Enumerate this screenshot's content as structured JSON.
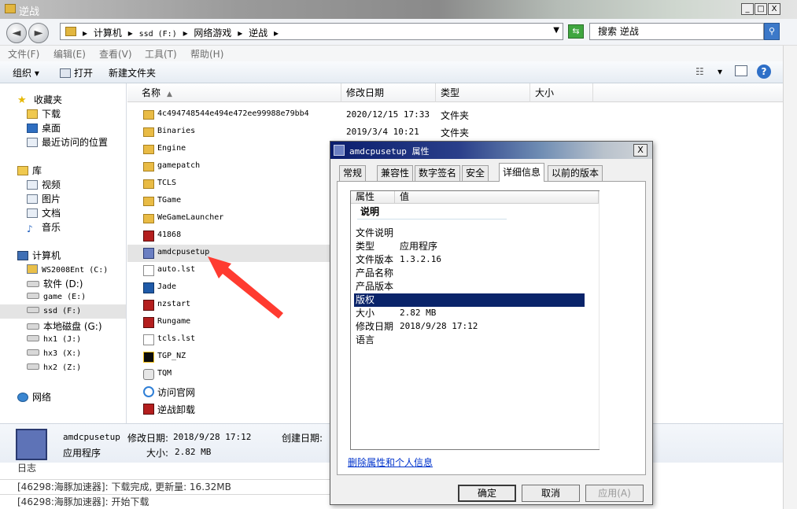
{
  "window": {
    "title": "逆战",
    "minimize": "_",
    "maximize": "□",
    "close": "X"
  },
  "address": {
    "crumbs": [
      "计算机",
      "▸",
      "ssd (F:)",
      "▸",
      "网络游戏",
      "▸",
      "逆战",
      "▸"
    ],
    "back": "◄",
    "forward": "►",
    "search_placeholder": "搜索 逆战"
  },
  "menu": {
    "file": "文件(F)",
    "edit": "编辑(E)",
    "view": "查看(V)",
    "tools": "工具(T)",
    "help": "帮助(H)"
  },
  "toolbar": {
    "organize": "组织 ▾",
    "open": "打开",
    "new_folder": "新建文件夹",
    "view_toggle": "▾",
    "help": "?"
  },
  "nav": {
    "favorites": "收藏夹",
    "downloads": "下载",
    "desktop": "桌面",
    "recent": "最近访问的位置",
    "libraries": "库",
    "videos": "视频",
    "pictures": "图片",
    "documents": "文档",
    "music": "音乐",
    "computer": "计算机",
    "drives": [
      "WS2008Ent (C:)",
      "软件 (D:)",
      "game (E:)",
      "ssd (F:)",
      "本地磁盘 (G:)",
      "hx1 (J:)",
      "hx3 (X:)",
      "hx2 (Z:)"
    ],
    "network": "网络"
  },
  "columns": {
    "name": "名称",
    "modified": "修改日期",
    "type": "类型",
    "size": "大小"
  },
  "files": [
    {
      "name": "4c494748544e494e472ee99988e79bb4",
      "date": "2020/12/15 17:33",
      "type": "文件夹"
    },
    {
      "name": "Binaries",
      "date": "2019/3/4 10:21",
      "type": "文件夹"
    },
    {
      "name": "Engine",
      "date": "",
      "type": ""
    },
    {
      "name": "gamepatch",
      "date": "",
      "type": ""
    },
    {
      "name": "TCLS",
      "date": "",
      "type": ""
    },
    {
      "name": "TGame",
      "date": "",
      "type": ""
    },
    {
      "name": "WeGameLauncher",
      "date": "",
      "type": ""
    },
    {
      "name": "41868",
      "date": "",
      "type": ""
    },
    {
      "name": "amdcpusetup",
      "date": "",
      "type": ""
    },
    {
      "name": "auto.lst",
      "date": "",
      "type": ""
    },
    {
      "name": "Jade",
      "date": "",
      "type": ""
    },
    {
      "name": "nzstart",
      "date": "",
      "type": ""
    },
    {
      "name": "Rungame",
      "date": "",
      "type": ""
    },
    {
      "name": "tcls.lst",
      "date": "",
      "type": ""
    },
    {
      "name": "TGP_NZ",
      "date": "",
      "type": ""
    },
    {
      "name": "TQM",
      "date": "",
      "type": ""
    },
    {
      "name": "访问官网",
      "date": "",
      "type": ""
    },
    {
      "name": "逆战卸载",
      "date": "",
      "type": ""
    }
  ],
  "details": {
    "name": "amdcpusetup",
    "modified_label": "修改日期:",
    "modified": "2018/9/28 17:12",
    "created_label": "创建日期:",
    "type": "应用程序",
    "size_label": "大小:",
    "size": "2.82 MB"
  },
  "log": {
    "title": "日志",
    "lines": [
      "[46298:海豚加速器]: 下载完成, 更新量: 16.32MB",
      "[46298:海豚加速器]: 开始下载"
    ]
  },
  "dialog": {
    "title": "amdcpusetup 属性",
    "close": "X",
    "tabs": [
      "常规",
      "兼容性",
      "数字签名",
      "安全",
      "详细信息",
      "以前的版本"
    ],
    "active_tab": "详细信息",
    "header_property": "属性",
    "header_value": "值",
    "section": "说明",
    "rows": [
      {
        "key": "文件说明",
        "value": ""
      },
      {
        "key": "类型",
        "value": "应用程序"
      },
      {
        "key": "文件版本",
        "value": "1.3.2.16"
      },
      {
        "key": "产品名称",
        "value": ""
      },
      {
        "key": "产品版本",
        "value": ""
      },
      {
        "key": "版权",
        "value": ""
      },
      {
        "key": "大小",
        "value": "2.82 MB"
      },
      {
        "key": "修改日期",
        "value": "2018/9/28 17:12"
      },
      {
        "key": "语言",
        "value": ""
      }
    ],
    "remove_link": "删除属性和个人信息",
    "ok": "确定",
    "cancel": "取消",
    "apply": "应用(A)"
  },
  "colors": {
    "selection": "#0a246a",
    "annotation_arrow": "#ff3b30"
  }
}
